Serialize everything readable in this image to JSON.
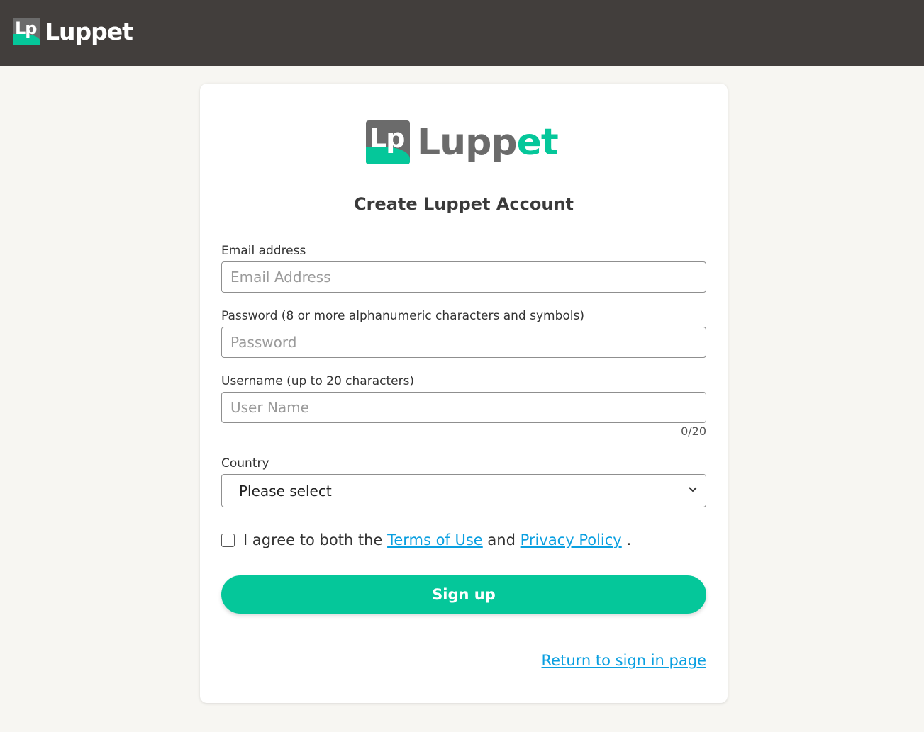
{
  "header": {
    "logo_mark": "Lp",
    "logo_text": "Luppet"
  },
  "card": {
    "logo_mark": "Lp",
    "logo_text_a": "Lupp",
    "logo_text_b": "et",
    "title": "Create Luppet Account"
  },
  "form": {
    "email_label": "Email address",
    "email_placeholder": "Email Address",
    "password_label": "Password (8 or more alphanumeric characters and symbols)",
    "password_placeholder": "Password",
    "username_label": "Username (up to 20 characters)",
    "username_placeholder": "User Name",
    "username_counter": "0/20",
    "country_label": "Country",
    "country_value": "Please select",
    "agree_prefix": "I agree to both the",
    "terms_link": "Terms of Use",
    "agree_and": "and",
    "privacy_link": "Privacy Policy",
    "agree_suffix": ".",
    "signup_label": "Sign up",
    "return_link": "Return to sign in page"
  },
  "colors": {
    "brand_green": "#05c79a",
    "header_bg": "#423e3c",
    "link_blue": "#0a9fe0",
    "page_bg": "#f7f6f2"
  }
}
